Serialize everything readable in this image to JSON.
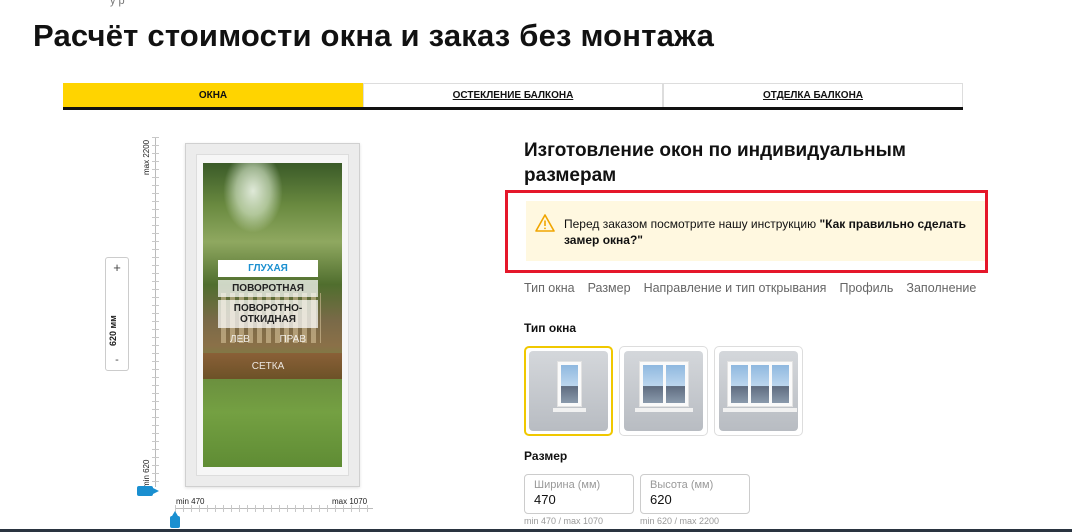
{
  "crumb": "у р",
  "page_title": "Расчёт стоимости окна и заказ без монтажа",
  "tabs": [
    {
      "label": "ОКНА"
    },
    {
      "label": "ОСТЕКЛЕНИЕ БАЛКОНА"
    },
    {
      "label": "ОТДЕЛКА БАЛКОНА"
    }
  ],
  "config": {
    "v_max": "max 2200",
    "v_min": "min 620",
    "h_min": "min 470",
    "h_max": "max 1070",
    "stepper": {
      "plus": "+",
      "minus": "-",
      "value": "620 мм"
    },
    "options": {
      "fixed": "ГЛУХАЯ",
      "turn": "ПОВОРОТНАЯ",
      "tilt_turn": "ПОВОРОТНО-ОТКИДНАЯ",
      "left": "ЛЕВ",
      "right": "ПРАВ",
      "mesh": "СЕТКА"
    }
  },
  "right": {
    "title": "Изготовление окон по индивидуальным размерам",
    "notice_prefix": "Перед заказом посмотрите нашу инструкцию ",
    "notice_link": "\"Как правильно сделать замер окна?\"",
    "subnav": [
      "Тип окна",
      "Размер",
      "Направление и тип открывания",
      "Профиль",
      "Заполнение"
    ],
    "type_label": "Тип окна",
    "size_label": "Размер",
    "width": {
      "placeholder": "Ширина (мм)",
      "value": "470",
      "hint": "min 470 / max 1070"
    },
    "height": {
      "placeholder": "Высота (мм)",
      "value": "620",
      "hint": "min 620 / max 2200"
    }
  }
}
